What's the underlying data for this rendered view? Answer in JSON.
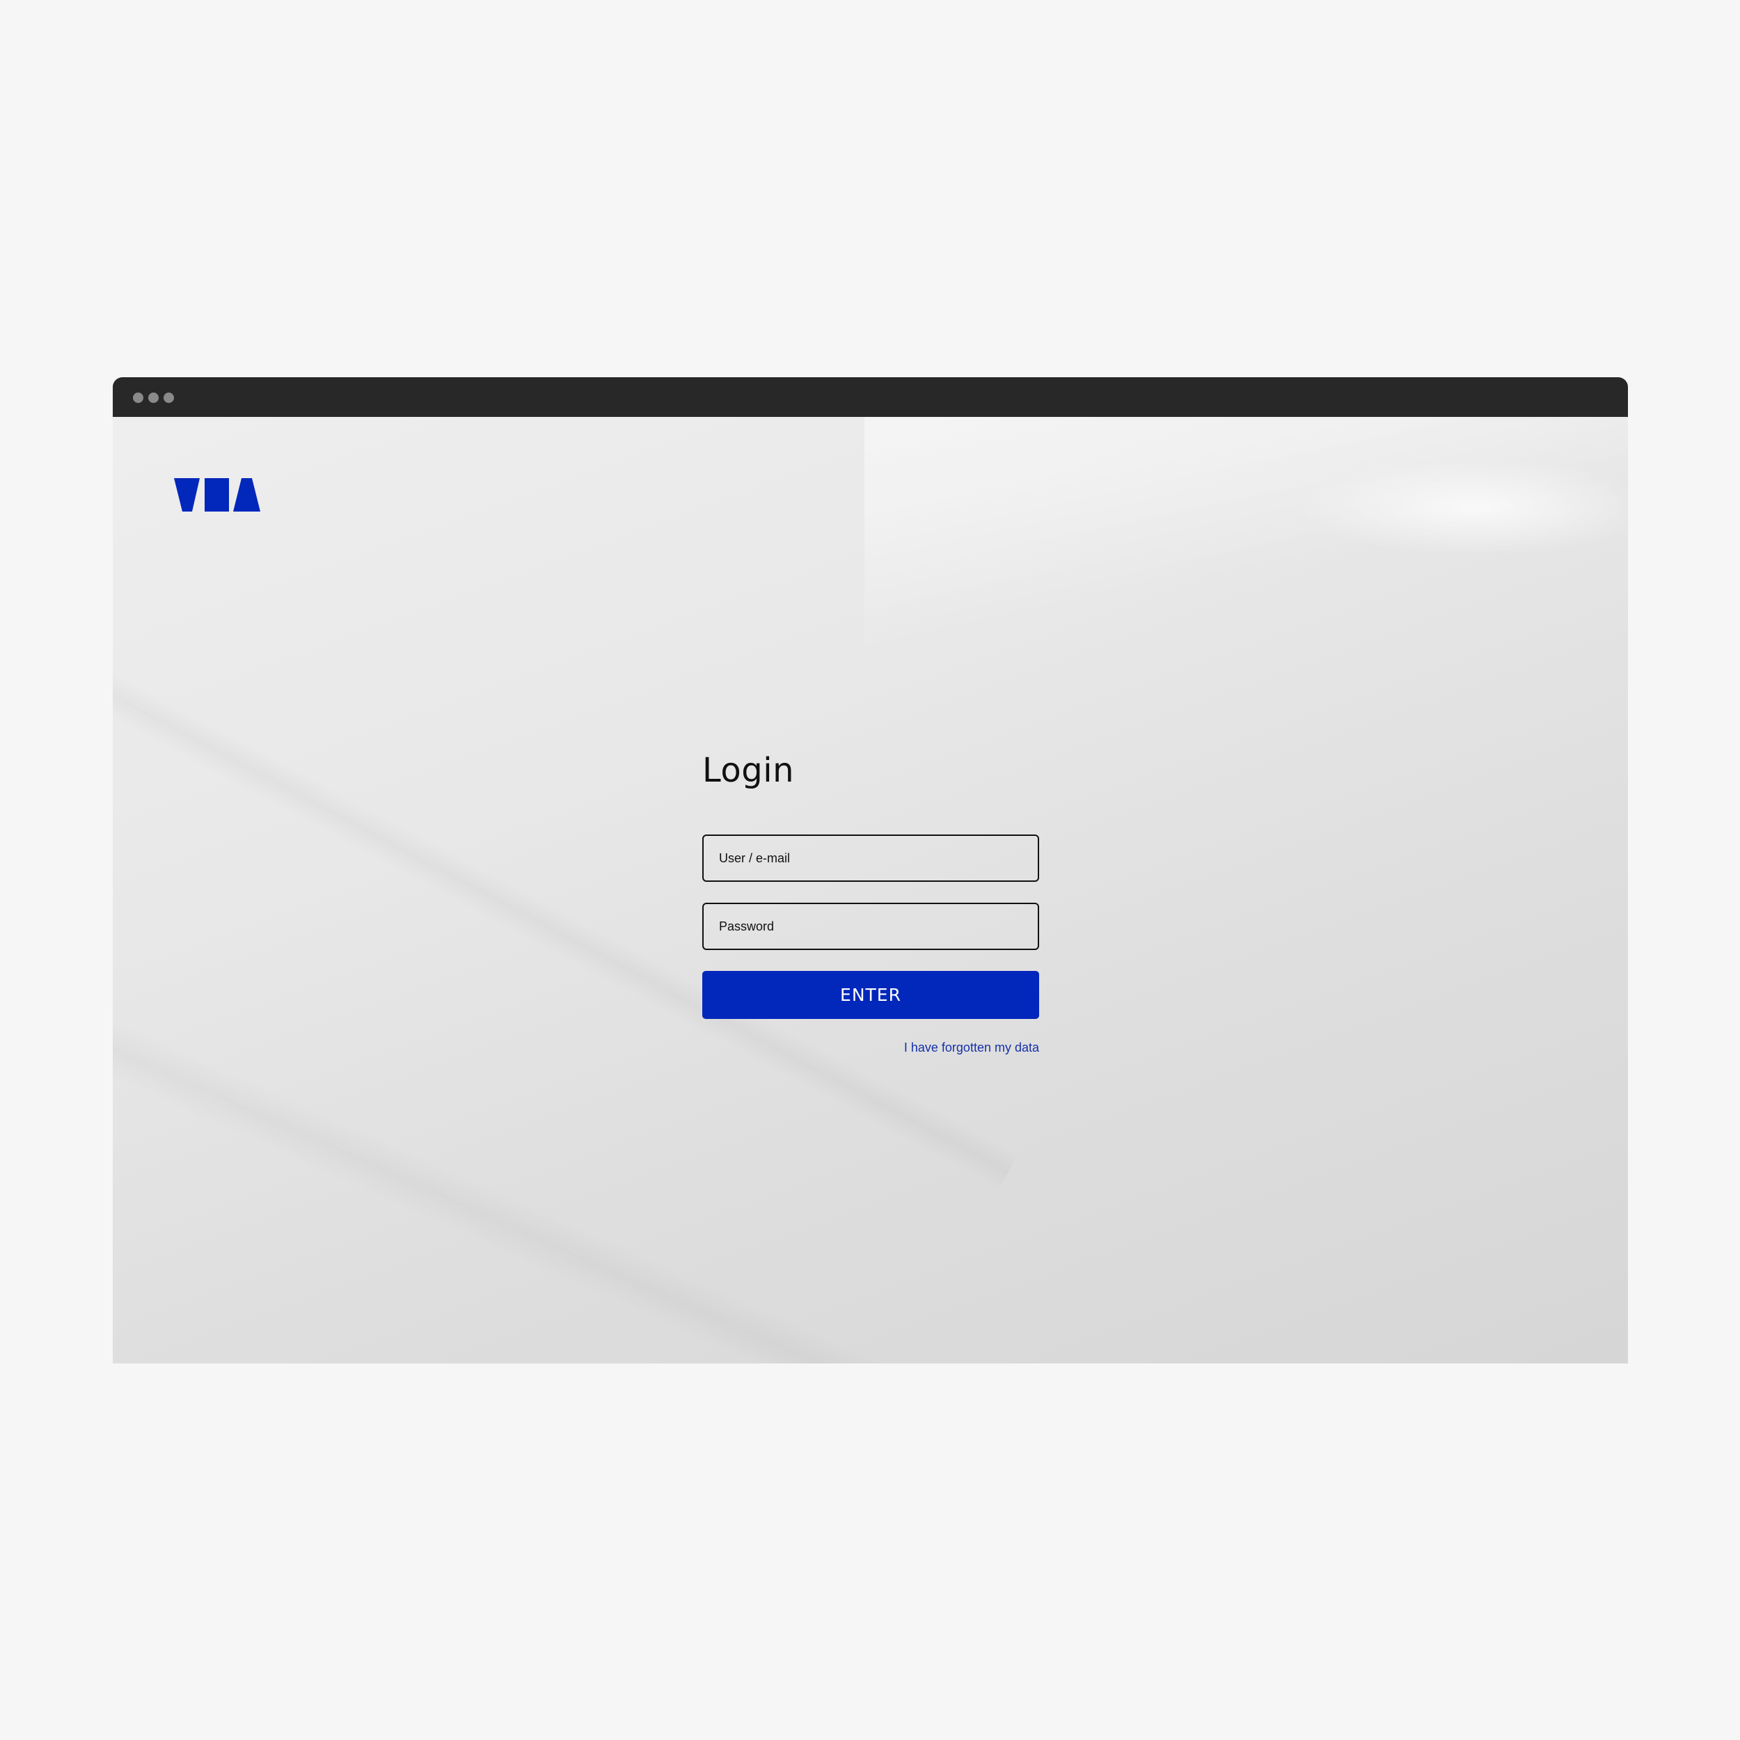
{
  "window": {
    "titlebar_controls": [
      "dot",
      "dot",
      "dot"
    ]
  },
  "brand": {
    "logo_icon": "vta-logo-icon",
    "color": "#0227bb"
  },
  "login": {
    "title": "Login",
    "user_field": {
      "value": "",
      "placeholder": "User / e-mail"
    },
    "password_field": {
      "value": "",
      "placeholder": "Password"
    },
    "submit_label": "ENTER",
    "forgot_link": "I have forgotten my data"
  },
  "colors": {
    "accent": "#0227bb",
    "titlebar": "#282828",
    "page_background": "#f6f6f6",
    "link": "#1630a8"
  }
}
